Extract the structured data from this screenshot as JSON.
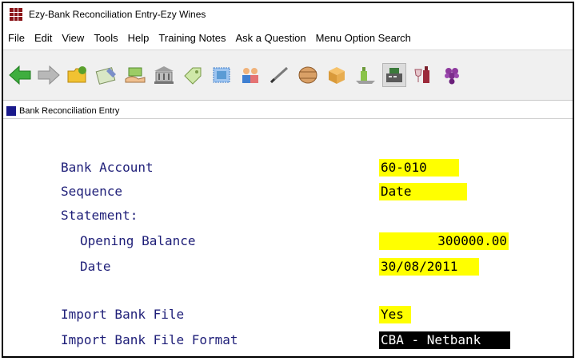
{
  "window": {
    "title": "Ezy-Bank Reconciliation Entry-Ezy Wines"
  },
  "menu": [
    "File",
    "Edit",
    "View",
    "Tools",
    "Help",
    "Training Notes",
    "Ask a Question",
    "Menu Option Search"
  ],
  "toolbar_icons": [
    "back-arrow-icon",
    "forward-arrow-icon",
    "folder-icon",
    "cheque-book-icon",
    "money-hand-icon",
    "bank-building-icon",
    "tag-icon",
    "stamp-icon",
    "people-icon",
    "pen-icon",
    "barrel-icon",
    "box-icon",
    "bottle-cart-icon",
    "cash-register-icon",
    "wine-glass-icon",
    "grapes-icon"
  ],
  "panel": {
    "title": "Bank Reconciliation Entry"
  },
  "form": {
    "bank_account_label": "Bank Account",
    "bank_account_value": "60-010",
    "sequence_label": "Sequence",
    "sequence_value": "Date",
    "statement_label": "Statement:",
    "opening_balance_label": "Opening Balance",
    "opening_balance_value": "300000.00",
    "date_label": "Date",
    "date_value": "30/08/2011",
    "import_bank_file_label": "Import Bank File",
    "import_bank_file_value": "Yes",
    "import_format_label": "Import Bank File Format",
    "import_format_value": "CBA - Netbank"
  },
  "colors": {
    "label_text": "#1e1e78",
    "field_highlight": "#ffff00",
    "selected_field": "#000000"
  }
}
